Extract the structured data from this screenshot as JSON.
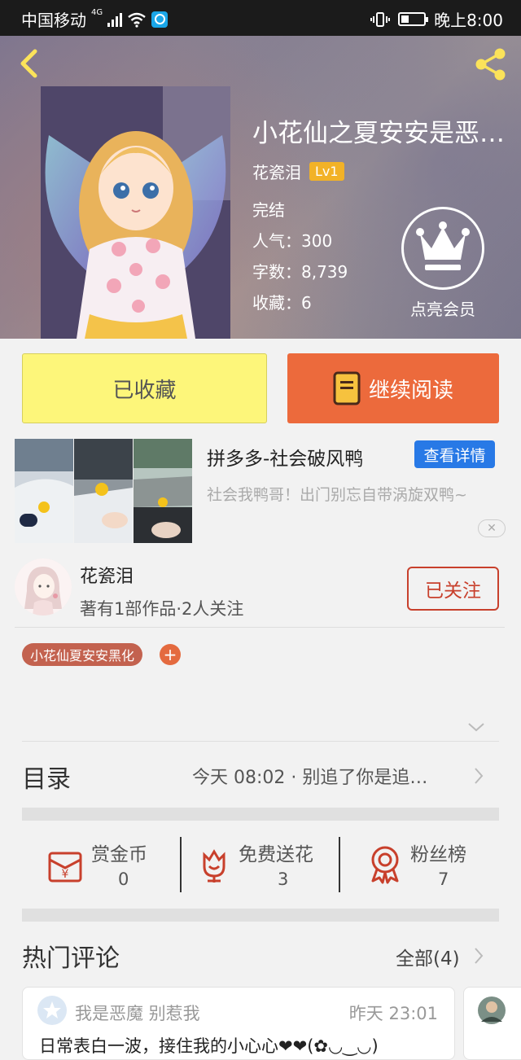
{
  "status_bar": {
    "carrier": "中国移动",
    "network": "4G",
    "time": "晚上8:00"
  },
  "book": {
    "title": "小花仙之夏安安是恶…",
    "author": "花瓷泪",
    "level": "Lv1",
    "status": "完结",
    "popularity": "人气：300",
    "word_count": "字数：8,739",
    "favorites": "收藏：6",
    "vip_label": "点亮会员"
  },
  "actions": {
    "collected_label": "已收藏",
    "continue_label": "继续阅读"
  },
  "ad": {
    "title": "拼多多-社会破风鸭",
    "detail_label": "查看详情",
    "description": "社会我鸭哥！出门别忘自带涡旋双鸭~",
    "close_label": "✕"
  },
  "author_card": {
    "name": "花瓷泪",
    "subtitle": "著有1部作品·2人关注",
    "follow_label": "已关注"
  },
  "tags": {
    "items": [
      "小花仙夏安安黑化"
    ],
    "add_label": "+"
  },
  "toc": {
    "label": "目录",
    "latest": "今天 08:02 · 别追了你是追…"
  },
  "stats": {
    "items": [
      {
        "label": "赏金币",
        "value": "0"
      },
      {
        "label": "免费送花",
        "value": "3"
      },
      {
        "label": "粉丝榜",
        "value": "7"
      }
    ]
  },
  "comments": {
    "label": "热门评论",
    "all_label": "全部(4)",
    "items": [
      {
        "user": "我是恶魔 别惹我",
        "time": "昨天 23:01",
        "text": "日常表白一波，接住我的小心心❤❤(✿◡‿◡)"
      }
    ]
  },
  "colors": {
    "accent_orange": "#ec6a3c",
    "collected_yellow": "#fdf67a",
    "level_badge": "#f2b227",
    "follow_red": "#c8402c",
    "tag_brown": "#c3624f",
    "ad_blue": "#2879e6"
  }
}
